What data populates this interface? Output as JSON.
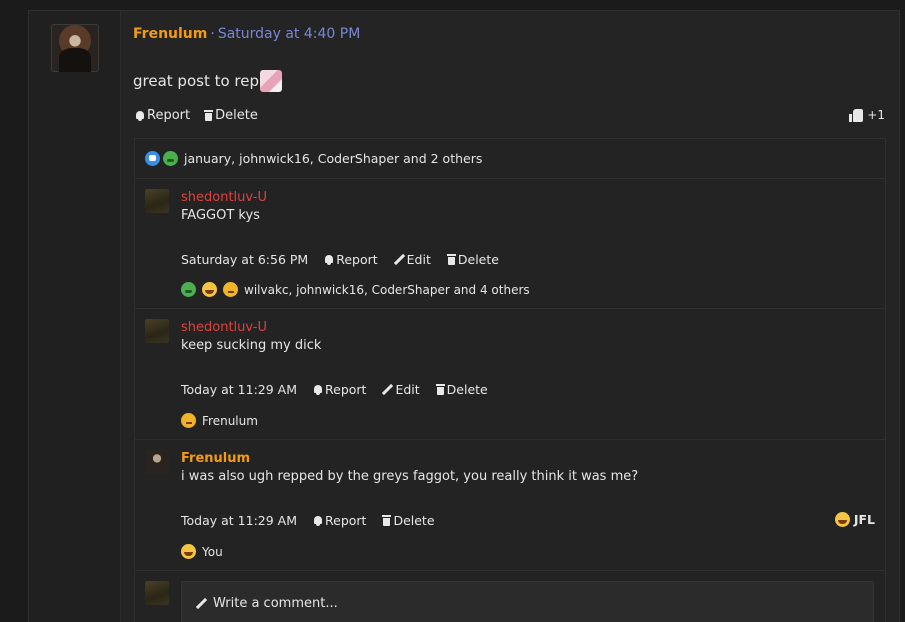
{
  "post": {
    "author": "Frenulum",
    "separator": "·",
    "time": "Saturday at 4:40 PM",
    "body": "great post to rep",
    "actions": {
      "report": "Report",
      "delete": "Delete"
    },
    "rating": "+1"
  },
  "reactions_summary": {
    "text": "january, johnwick16, CoderShaper and 2 others"
  },
  "comments": [
    {
      "author": "shedontluv-U",
      "text": "FAGGOT kys",
      "time": "Saturday at 6:56 PM",
      "report": "Report",
      "edit": "Edit",
      "delete": "Delete",
      "reactions_text": "wilvakc, johnwick16, CoderShaper and 4 others"
    },
    {
      "author": "shedontluv-U",
      "text": "keep sucking my dick",
      "time": "Today at 11:29 AM",
      "report": "Report",
      "edit": "Edit",
      "delete": "Delete",
      "reactions_text": "Frenulum"
    },
    {
      "author": "Frenulum",
      "text": "i was also ugh repped by the greys faggot, you really think it was me?",
      "time": "Today at 11:29 AM",
      "report": "Report",
      "delete": "Delete",
      "reactions_text": "You",
      "reaction_label": "JFL"
    }
  ],
  "write_comment": {
    "placeholder": "Write a comment..."
  },
  "colors": {
    "author_orange": "#f39c12",
    "author_red": "#e0413b",
    "time_blue": "#7b86d6",
    "background": "#1b1b1b"
  }
}
